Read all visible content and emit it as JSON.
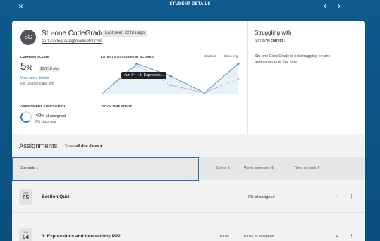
{
  "header": {
    "close_icon": "×",
    "title": "STUDENT DETAILS",
    "prev_icon": "‹",
    "next_icon": "›"
  },
  "student": {
    "initials": "SC",
    "name": "Stu-one CodeGrade",
    "last_seen": "Last seen 22 hrs ago",
    "email": "stu1-codegrade@mailinator.com"
  },
  "current_score": {
    "label": "CURRENT SCORE",
    "value": "5",
    "unit": "%",
    "points": "10/210 pts",
    "link": "View score details",
    "class_avg": "6% (35 pts) class avg"
  },
  "latest_scores": {
    "label": "LATEST 4 ASSIGNMENT SCORES",
    "legend_student": "Student",
    "legend_class": "Class avg",
    "tooltip": "Jun 04 • 3: Expressio..."
  },
  "chart_data": {
    "type": "line",
    "x": [
      1,
      2,
      3,
      4,
      5
    ],
    "series": [
      {
        "name": "Student",
        "values": [
          5,
          100,
          60,
          5,
          100
        ]
      },
      {
        "name": "Class avg",
        "values": [
          5,
          95,
          30,
          5,
          50
        ]
      }
    ],
    "ylim": [
      0,
      110
    ],
    "grid": false,
    "colors": {
      "student": "#3a8fc4",
      "class": "#9a7aa8"
    }
  },
  "completion": {
    "label": "ASSIGNMENT COMPLETION",
    "value": "40",
    "suffix": "% of assigned",
    "class_avg": "6% class avg",
    "fraction": 0.4
  },
  "time_spent": {
    "label": "TOTAL TIME SPENT",
    "value": "–"
  },
  "struggling": {
    "title": "Struggling with",
    "sort_prefix": "Sort by ",
    "sort_value": "% correct ↓",
    "text": "Stu-one CodeGrade is not struggling on any assessments at this time."
  },
  "assignments": {
    "title": "Assignments",
    "show_prefix": "Show ",
    "show_value": "all due dates ▾",
    "columns": {
      "due": "Due date ↓",
      "score": "Score ⇕",
      "work": "Work complete ⇕",
      "time": "Time on task ⇕"
    },
    "rows": [
      {
        "month": "JUN",
        "day": "05",
        "title": "Section Quiz",
        "score": "",
        "work": "0% of assigned"
      },
      {
        "month": "JUN",
        "day": "04",
        "title": "3: Expressions and Interactivity PP2",
        "score": "100%",
        "work": "100% of assigned"
      }
    ],
    "chevron_icon": "⌄",
    "kebab_icon": "⋮"
  }
}
